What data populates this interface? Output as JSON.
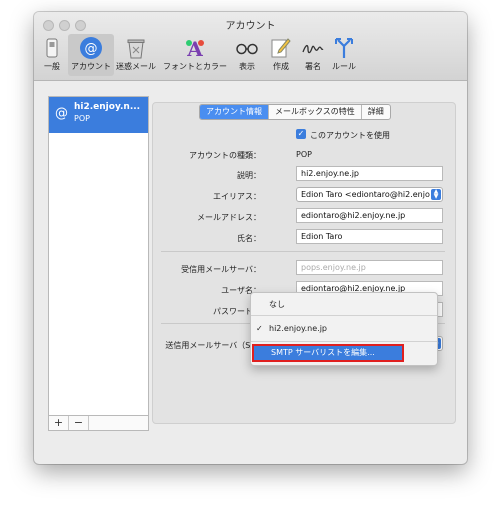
{
  "window": {
    "title": "アカウント"
  },
  "toolbar": {
    "items": [
      {
        "label": "一般",
        "icon": "general-switch-icon"
      },
      {
        "label": "アカウント",
        "icon": "at-sign-icon"
      },
      {
        "label": "迷惑メール",
        "icon": "junk-trash-icon"
      },
      {
        "label": "フォントとカラー",
        "icon": "font-color-icon"
      },
      {
        "label": "表示",
        "icon": "glasses-icon"
      },
      {
        "label": "作成",
        "icon": "compose-pencil-icon"
      },
      {
        "label": "署名",
        "icon": "signature-icon"
      },
      {
        "label": "ルール",
        "icon": "rules-arrow-icon"
      }
    ]
  },
  "accounts": {
    "items": [
      {
        "name": "hi2.enjoy.n...",
        "type": "POP"
      }
    ],
    "add_label": "+",
    "remove_label": "−"
  },
  "tabs": [
    "アカウント情報",
    "メールボックスの特性",
    "詳細"
  ],
  "form": {
    "enable_label": "このアカウントを使用",
    "type_label": "アカウントの種類：",
    "type_value": "POP",
    "desc_label": "説明：",
    "desc_value": "hi2.enjoy.ne.jp",
    "alias_label": "エイリアス：",
    "alias_value": "Edion Taro <ediontaro@hi2.enjo",
    "email_label": "メールアドレス：",
    "email_value": "ediontaro@hi2.enjoy.ne.jp",
    "name_label": "氏名：",
    "name_value": "Edion Taro",
    "incoming_label": "受信用メールサーバ：",
    "incoming_placeholder": "pops.enjoy.ne.jp",
    "user_label": "ユーザ名：",
    "user_value": "ediontaro@hi2.enjoy.ne.jp",
    "password_label": "パスワード：",
    "password_value": "••••••••",
    "smtp_label": "送信用メールサーバ（SMTP）："
  },
  "smtp_menu": {
    "items": [
      "なし",
      "hi2.enjoy.ne.jp",
      "SMTP サーバリストを編集..."
    ],
    "checked": "✓"
  },
  "help": "?",
  "colors": {
    "accent": "#3b7ddd",
    "highlight_outline": "#e02020"
  }
}
